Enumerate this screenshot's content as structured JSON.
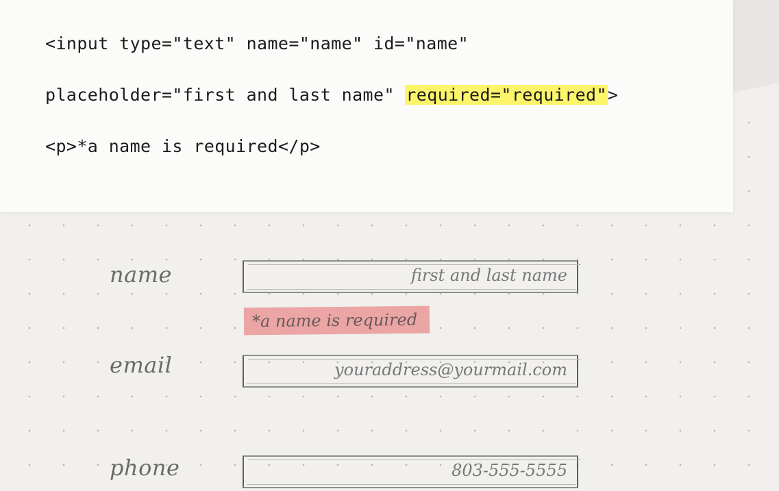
{
  "code": {
    "line1": "<input type=\"text\" name=\"name\" id=\"name\"",
    "line2_before": "placeholder=\"first and last name\" ",
    "line2_highlight": "required=\"required\"",
    "line2_after": ">",
    "line3": "<p>*a name is required</p>"
  },
  "form": {
    "name_label": "name",
    "name_placeholder": "first and last name",
    "name_error": "*a name is required",
    "email_label": "email",
    "email_placeholder": "youraddress@yourmail.com",
    "phone_label": "phone",
    "phone_placeholder": "803-555-5555"
  },
  "colors": {
    "highlight": "#fcf56b",
    "error_background": "#eba5a5"
  }
}
